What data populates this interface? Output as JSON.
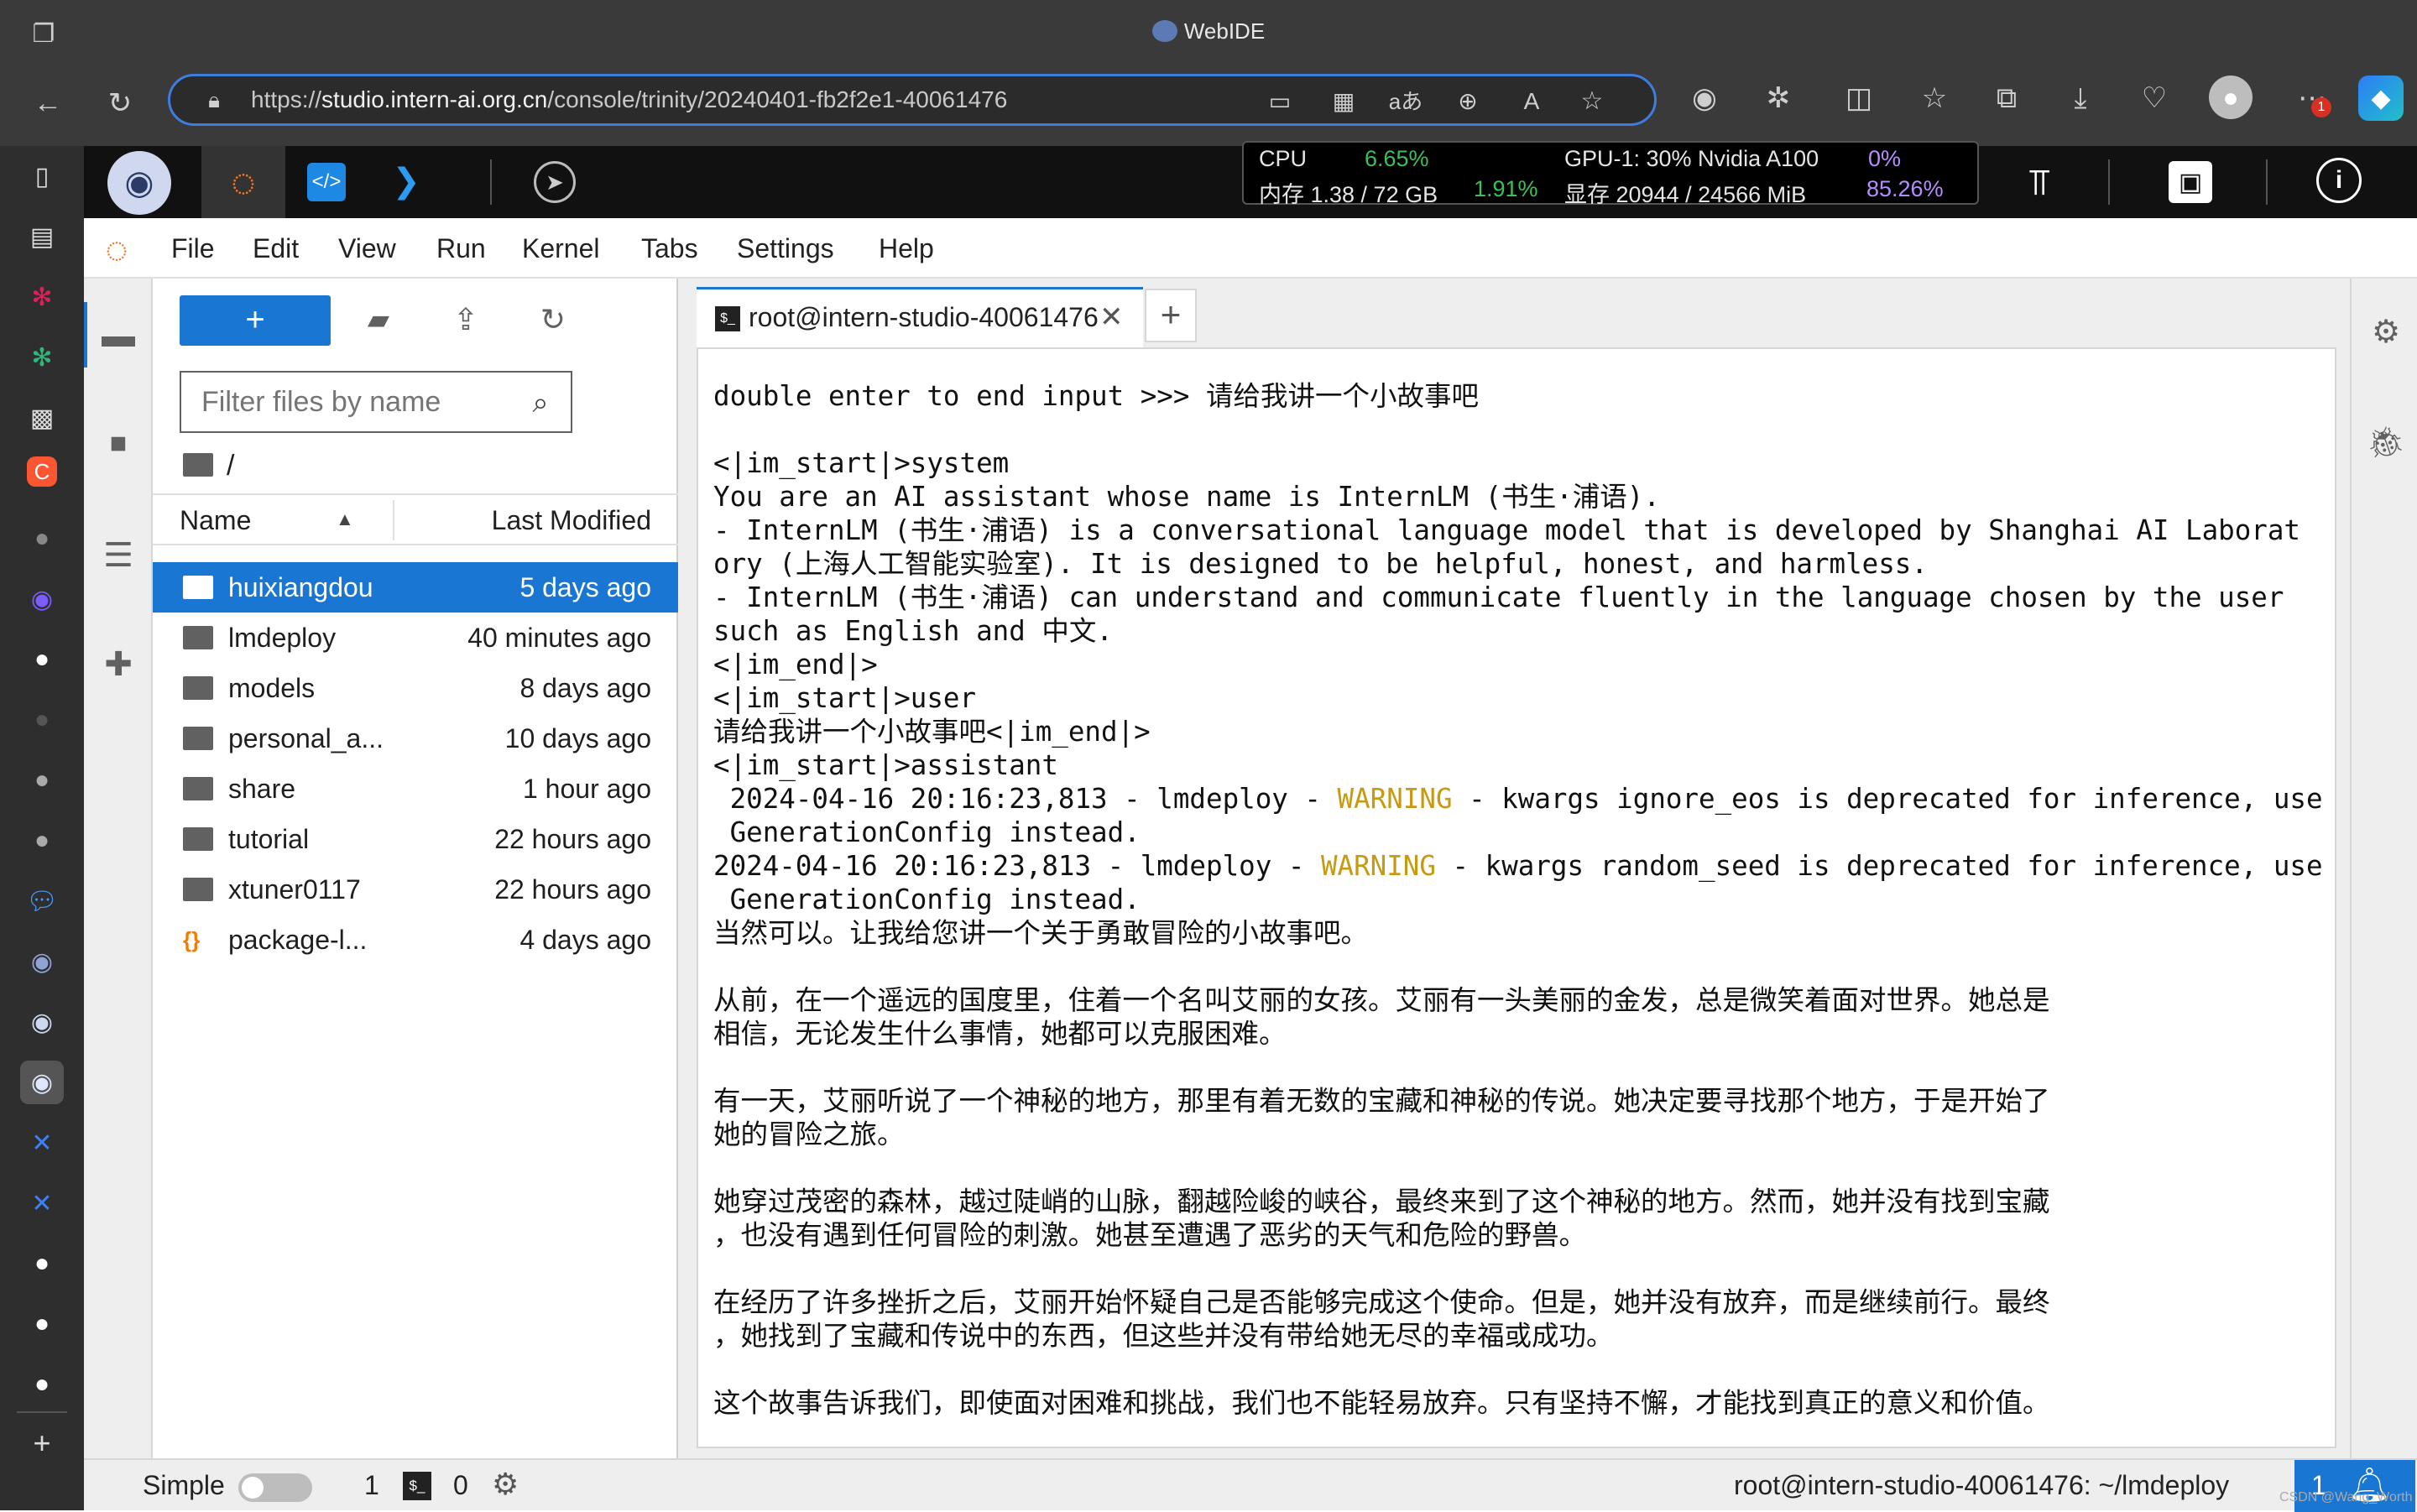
{
  "window": {
    "title": "WebIDE"
  },
  "browser": {
    "url_prefix": "https://",
    "url_host": "studio.intern-ai.org.cn",
    "url_path": "/console/trinity/20240401-fb2f2e1-40061476",
    "badge_count": "1"
  },
  "monitor": {
    "cpu_label": "CPU",
    "cpu_value": "6.65%",
    "mem_label": "内存 1.38 / 72 GB",
    "mem_value": "1.91%",
    "gpu_label": "GPU-1: 30% Nvidia A100",
    "gpu_value": "0%",
    "vram_label": "显存 20944 / 24566 MiB",
    "vram_value": "85.26%"
  },
  "menu": [
    "File",
    "Edit",
    "View",
    "Run",
    "Kernel",
    "Tabs",
    "Settings",
    "Help"
  ],
  "filebrowser": {
    "filter_placeholder": "Filter files by name",
    "path": "/",
    "col_name": "Name",
    "col_modified": "Last Modified",
    "new_button": "+",
    "files": [
      {
        "name": "huixiangdou",
        "modified": "5 days ago",
        "type": "folder",
        "selected": true
      },
      {
        "name": "lmdeploy",
        "modified": "40 minutes ago",
        "type": "folder"
      },
      {
        "name": "models",
        "modified": "8 days ago",
        "type": "folder"
      },
      {
        "name": "personal_a...",
        "modified": "10 days ago",
        "type": "folder"
      },
      {
        "name": "share",
        "modified": "1 hour ago",
        "type": "folder"
      },
      {
        "name": "tutorial",
        "modified": "22 hours ago",
        "type": "folder"
      },
      {
        "name": "xtuner0117",
        "modified": "22 hours ago",
        "type": "folder"
      },
      {
        "name": "package-l...",
        "modified": "4 days ago",
        "type": "json"
      }
    ]
  },
  "tab": {
    "label": "root@intern-studio-40061476",
    "add": "+"
  },
  "terminal": {
    "lines": [
      "double enter to end input >>> 请给我讲一个小故事吧",
      "",
      "<|im_start|>system",
      "You are an AI assistant whose name is InternLM (书生·浦语).",
      "- InternLM (书生·浦语) is a conversational language model that is developed by Shanghai AI Laborat",
      "ory (上海人工智能实验室). It is designed to be helpful, honest, and harmless.",
      "- InternLM (书生·浦语) can understand and communicate fluently in the language chosen by the user",
      "such as English and 中文.",
      "<|im_end|>",
      "<|im_start|>user",
      "请给我讲一个小故事吧<|im_end|>",
      "<|im_start|>assistant",
      " 2024-04-16 20:16:23,813 - lmdeploy - @@WARNING@@ - kwargs ignore_eos is deprecated for inference, use",
      " GenerationConfig instead.",
      "2024-04-16 20:16:23,813 - lmdeploy - @@WARNING@@ - kwargs random_seed is deprecated for inference, use",
      " GenerationConfig instead.",
      "当然可以。让我给您讲一个关于勇敢冒险的小故事吧。",
      "",
      "从前，在一个遥远的国度里，住着一个名叫艾丽的女孩。艾丽有一头美丽的金发，总是微笑着面对世界。她总是",
      "相信，无论发生什么事情，她都可以克服困难。",
      "",
      "有一天，艾丽听说了一个神秘的地方，那里有着无数的宝藏和神秘的传说。她决定要寻找那个地方，于是开始了",
      "她的冒险之旅。",
      "",
      "她穿过茂密的森林，越过陡峭的山脉，翻越险峻的峡谷，最终来到了这个神秘的地方。然而，她并没有找到宝藏",
      "，也没有遇到任何冒险的刺激。她甚至遭遇了恶劣的天气和危险的野兽。",
      "",
      "在经历了许多挫折之后，艾丽开始怀疑自己是否能够完成这个使命。但是，她并没有放弃，而是继续前行。最终",
      "，她找到了宝藏和传说中的东西，但这些并没有带给她无尽的幸福或成功。",
      "",
      "这个故事告诉我们，即使面对困难和挑战，我们也不能轻易放弃。只有坚持不懈，才能找到真正的意义和价值。"
    ]
  },
  "statusbar": {
    "mode": "Simple",
    "kernels": "1",
    "terminals": "0",
    "right_text": "root@intern-studio-40061476: ~/lmdeploy",
    "notif_count": "1",
    "watermark": "CSDN @Wang_Worth"
  },
  "colors": {
    "accent": "#1976d2",
    "warning": "#c79a14",
    "cpu_green": "#3dbf5a",
    "gpu_purple": "#b78cff"
  }
}
